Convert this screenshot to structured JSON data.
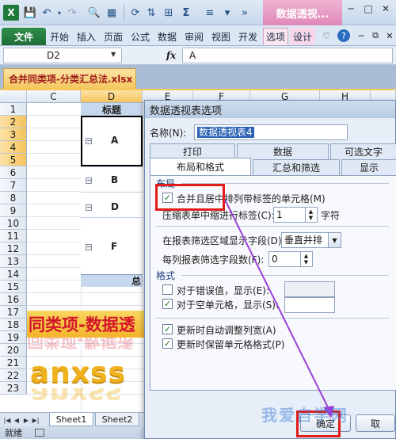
{
  "qat": {
    "context_title": "数据透视...",
    "win_min": "─",
    "win_max": "□",
    "win_close": "✕"
  },
  "ribbon": {
    "tabs": [
      "文件",
      "开始",
      "插入",
      "页面",
      "公式",
      "数据",
      "审阅",
      "视图",
      "开发",
      "选项",
      "设计"
    ],
    "file_tab": "文件",
    "help": "?"
  },
  "formula_bar": {
    "name_box": "D2",
    "fx": "fx",
    "formula": "A"
  },
  "workbook": {
    "tab_title": "合并同类项-分类汇总法.xlsx",
    "close": "✕"
  },
  "grid": {
    "columns": [
      "C",
      "D",
      "E",
      "F",
      "G",
      "H"
    ],
    "selected_column": "D",
    "rows": [
      "1",
      "2",
      "3",
      "4",
      "5",
      "6",
      "7",
      "8",
      "9",
      "10",
      "11",
      "12",
      "13",
      "14",
      "15",
      "16",
      "17",
      "18",
      "19",
      "20",
      "21",
      "22",
      "23"
    ],
    "pivot_header": "标题",
    "pivot_items": [
      "A",
      "B",
      "D",
      "F"
    ],
    "pivot_total": "总",
    "banner_text": "同类项-数据透",
    "logo_text": "anxss"
  },
  "sheets": {
    "tabs": [
      "Sheet1",
      "Sheet2"
    ]
  },
  "status": {
    "text": "就绪"
  },
  "dialog": {
    "title": "数据透视表选项",
    "name_label": "名称(N):",
    "name_value": "数据透视表4",
    "tabs_row1": [
      "打印",
      "数据",
      "可选文字"
    ],
    "tabs_row2": [
      "布局和格式",
      "汇总和筛选",
      "显示"
    ],
    "active_tab": "布局和格式",
    "layout_group": "布局",
    "merge_label": "合并且居中排列带标签的单元格(M)",
    "merge_checked": true,
    "indent_label": "压缩表单中缩进行标签(C):",
    "indent_value": "1",
    "indent_unit": "字符",
    "filter_area_label": "在报表筛选区域显示字段(D):",
    "filter_area_value": "垂直并排",
    "filter_count_label": "每列报表筛选字段数(F):",
    "filter_count_value": "0",
    "format_group": "格式",
    "error_label": "对于错误值，显示(E):",
    "error_checked": false,
    "empty_label": "对于空单元格，显示(S):",
    "empty_checked": true,
    "autofit_label": "更新时自动调整列宽(A)",
    "autofit_checked": true,
    "preserve_label": "更新时保留单元格格式(P)",
    "preserve_checked": true,
    "ok_label": "确定",
    "cancel_label": "取"
  },
  "watermark": "我爱自学网"
}
